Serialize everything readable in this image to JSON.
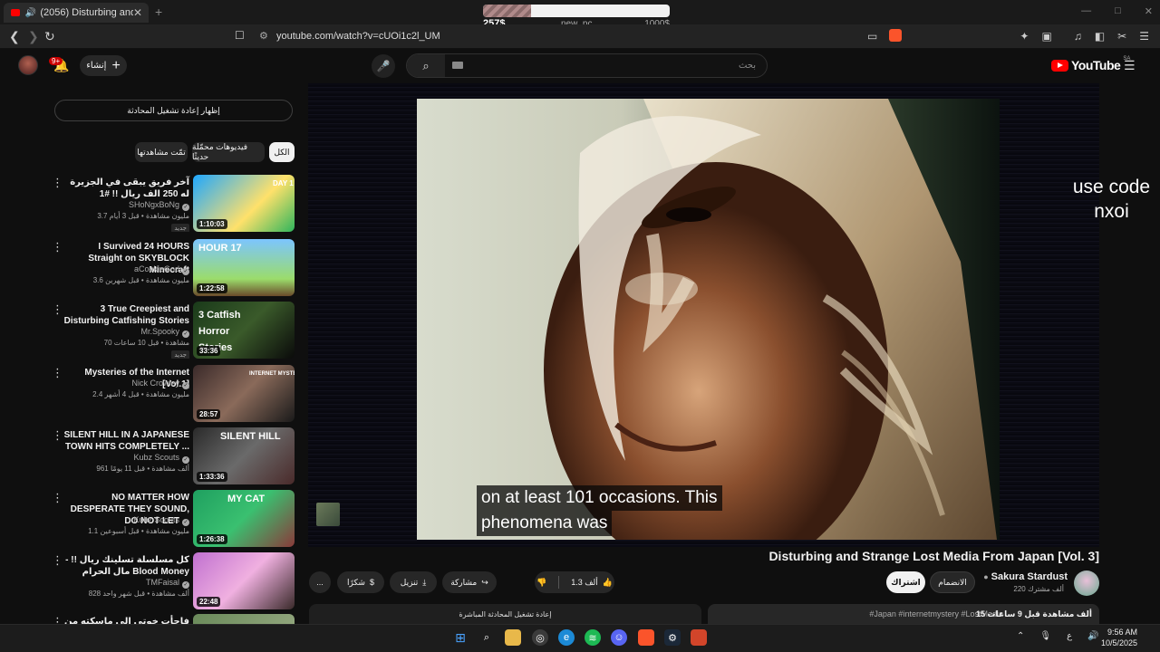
{
  "browser": {
    "tab_title": "(2056) Disturbing and Strange",
    "tab_close": "✕",
    "new_tab": "+",
    "url": "youtube.com/watch?v=cUOi1c2l_UM",
    "window_controls": [
      "—",
      "□",
      "✕"
    ]
  },
  "donation_bar": {
    "current": "257$",
    "label": "new_pc",
    "goal": "1000$",
    "progress_fraction": 0.257
  },
  "youtube": {
    "logo_text": "YouTube",
    "region": "SA",
    "notification_count": "9+",
    "create_label": "إنشاء",
    "search_placeholder": "بحث"
  },
  "sidebar": {
    "chat_replay": "إظهار إعادة تشغيل المحادثة",
    "chips": [
      "الكل",
      "فيديوهات محمّلة حديثًا",
      "تمّت مشاهدتها"
    ],
    "new_badge": "جديد",
    "recommendations": [
      {
        "title": "آخر فريق يبقى في الجزيرة له 250 الف ريال !! #1",
        "channel": "SHoNgxBoNg",
        "meta": "3.7 مليون مشاهدة • قبل 3 أيام",
        "duration": "1:10:03",
        "new": true,
        "thumb_text": "DAY 1"
      },
      {
        "title": "I Survived 24 HOURS Straight on SKYBLOCK Minecraft",
        "channel": "aCookieGod",
        "meta": "3.6 مليون مشاهدة • قبل شهرين",
        "duration": "1:22:58",
        "new": false,
        "thumb_text": "HOUR 17"
      },
      {
        "title": "3 True Creepiest and Disturbing Catfishing Stories",
        "channel": "Mr.Spooky",
        "meta": "70 مشاهدة • قبل 10 ساعات",
        "duration": "33:36",
        "new": true,
        "thumb_text": "3 Catfish Horror Stories"
      },
      {
        "title": "Mysteries of the Internet [Vol.1]",
        "channel": "Nick Crowley",
        "meta": "2.4 مليون مشاهدة • قبل 4 أشهر",
        "duration": "28:57",
        "new": false,
        "thumb_text": "INTERNET MYSTERIES"
      },
      {
        "title": "SILENT HILL IN A JAPANESE TOWN HITS COMPLETELY ...",
        "channel": "Kubz Scouts",
        "meta": "961 ألف مشاهدة • قبل 11 يومًا",
        "duration": "1:33:36",
        "new": false,
        "thumb_text": "SILENT HILL"
      },
      {
        "title": "NO MATTER HOW DESPERATE THEY SOUND, DO NOT LET ...",
        "channel": "Kubz Scouts",
        "meta": "1.1 مليون مشاهدة • قبل أسبوعين",
        "duration": "1:26:38",
        "new": false,
        "thumb_text": "MY CAT"
      },
      {
        "title": "كل مسلسلة تسلينك ريال !! - مال الحرام Blood Money",
        "channel": "TMFaisal",
        "meta": "828 ألف مشاهدة • قبل شهر واحد",
        "duration": "22:48",
        "new": false,
        "thumb_text": ""
      },
      {
        "title": "فاجأت خوتي الي ماسكته من سجين !",
        "channel": "",
        "meta": "",
        "duration": "",
        "new": false,
        "thumb_text": ""
      }
    ]
  },
  "player": {
    "overlay_text": [
      "use code",
      "nxoi"
    ],
    "subtitle_lines": [
      "on at least 101 occasions. This",
      "phenomena was"
    ]
  },
  "video": {
    "title": "Disturbing and Strange Lost Media From Japan [Vol. 3]",
    "channel": "Sakura Stardust",
    "subscribers": "220 ألف مشترك",
    "subscribe": "اشتراك",
    "join": "الانضمام",
    "likes": "1.3 ألف",
    "share": "مشاركة",
    "download": "تنزيل",
    "thanks": "شكرًا",
    "more": "...",
    "views": "15 ألف مشاهدة قبل 9 ساعات",
    "tags": "#Japan #internetmystery #LostMedia",
    "chat_bar": "إعادة تشغيل المحادثة المباشرة"
  },
  "taskbar": {
    "time": "9:56 AM",
    "date": "10/5/2025",
    "lang": "ع"
  }
}
